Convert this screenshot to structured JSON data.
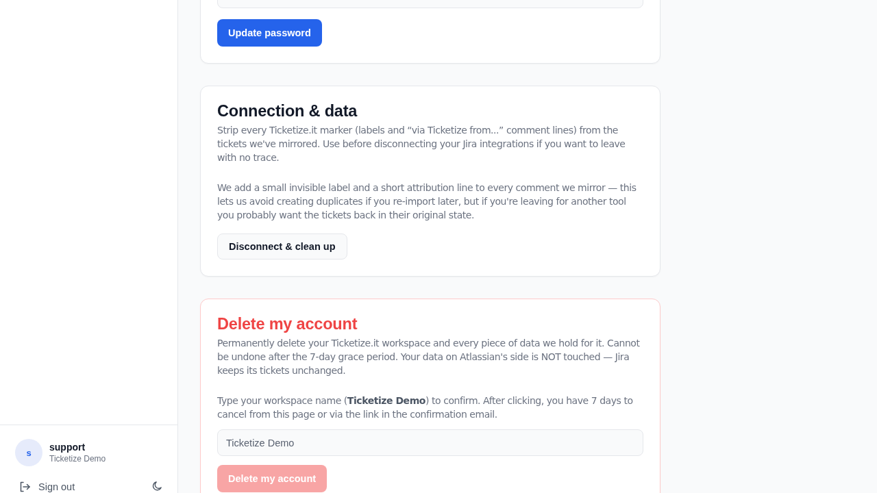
{
  "sidebar": {
    "user": {
      "avatar_initial": "s",
      "name": "support",
      "workspace": "Ticketize Demo"
    },
    "sign_out": "Sign out"
  },
  "sections": [
    {
      "kind": "password",
      "button": {
        "label": "Update password",
        "disabled": false
      }
    },
    {
      "kind": "info",
      "title": "Connection & data",
      "paragraphs": [
        "Strip every Ticketize.it marker (labels and “via Ticketize from...” comment lines) from the tickets we've mirrored. Use before disconnecting your Jira integrations if you want to leave with no trace.",
        "We add a small invisible label and a short attribution line to every comment we mirror — this lets us avoid creating duplicates if you re-import later, but if you're leaving for another tool you probably want the tickets back in their original state."
      ],
      "button": {
        "label": "Disconnect & clean up",
        "disabled": false
      }
    },
    {
      "kind": "danger",
      "title": "Delete my account",
      "paragraphs": [
        "Permanently delete your Ticketize.it workspace and every piece of data we hold for it. Cannot be undone after the 7-day grace period. Your data on Atlassian's side is NOT touched — Jira keeps its tickets unchanged.",
        "Type your workspace name (**Ticketize Demo**) to confirm. After clicking, you have 7 days to cancel from this page or via the link in the confirmation email."
      ],
      "input": {
        "placeholder": "Ticketize Demo"
      },
      "button": {
        "label": "Delete my account",
        "disabled": true
      }
    }
  ]
}
